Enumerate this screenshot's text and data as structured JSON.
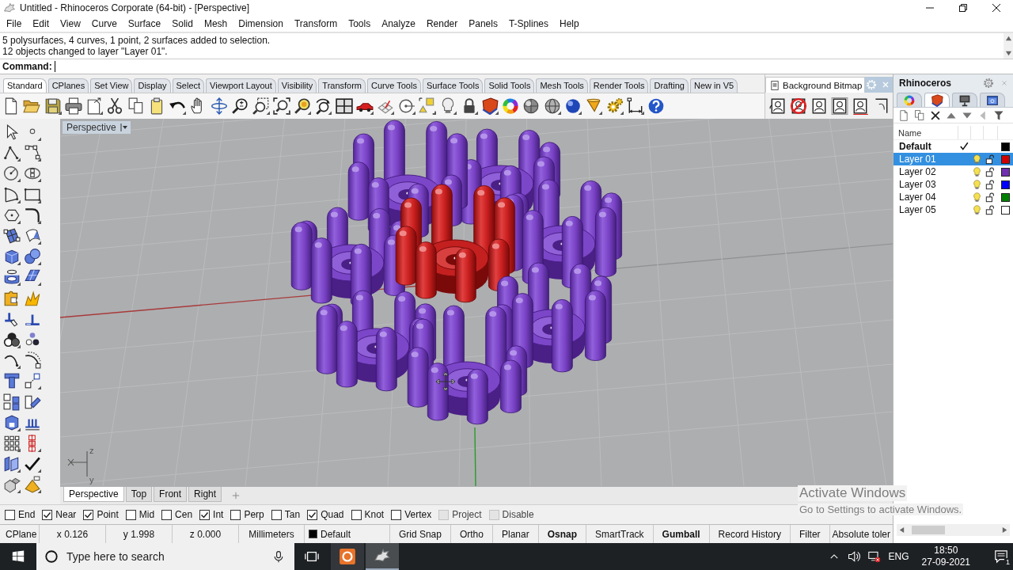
{
  "window": {
    "title": "Untitled - Rhinoceros Corporate (64-bit) - [Perspective]"
  },
  "menu": [
    "File",
    "Edit",
    "View",
    "Curve",
    "Surface",
    "Solid",
    "Mesh",
    "Dimension",
    "Transform",
    "Tools",
    "Analyze",
    "Render",
    "Panels",
    "T-Splines",
    "Help"
  ],
  "command_history": [
    "5 polysurfaces, 4 curves, 1 point, 2 surfaces added to selection.",
    "12 objects changed to layer \"Layer 01\"."
  ],
  "command": {
    "label": "Command:"
  },
  "toolbar_tabs": [
    {
      "label": "Standard",
      "selected": true
    },
    {
      "label": "CPlanes",
      "selected": false
    },
    {
      "label": "Set View",
      "selected": false
    },
    {
      "label": "Display",
      "selected": false
    },
    {
      "label": "Select",
      "selected": false
    },
    {
      "label": "Viewport Layout",
      "selected": false
    },
    {
      "label": "Visibility",
      "selected": false
    },
    {
      "label": "Transform",
      "selected": false
    },
    {
      "label": "Curve Tools",
      "selected": false
    },
    {
      "label": "Surface Tools",
      "selected": false
    },
    {
      "label": "Solid Tools",
      "selected": false
    },
    {
      "label": "Mesh Tools",
      "selected": false
    },
    {
      "label": "Render Tools",
      "selected": false
    },
    {
      "label": "Drafting",
      "selected": false
    },
    {
      "label": "New in V5",
      "selected": false
    }
  ],
  "bitmap_panel": {
    "title": "Background Bitmap"
  },
  "viewport": {
    "title": "Perspective",
    "axis_labels": [
      "z",
      "y"
    ]
  },
  "viewport_tabs": [
    {
      "label": "Perspective",
      "selected": true
    },
    {
      "label": "Top",
      "selected": false
    },
    {
      "label": "Front",
      "selected": false
    },
    {
      "label": "Right",
      "selected": false
    }
  ],
  "osnaps": [
    {
      "label": "End",
      "checked": false,
      "disabled": false
    },
    {
      "label": "Near",
      "checked": true,
      "disabled": false
    },
    {
      "label": "Point",
      "checked": true,
      "disabled": false
    },
    {
      "label": "Mid",
      "checked": false,
      "disabled": false
    },
    {
      "label": "Cen",
      "checked": false,
      "disabled": false
    },
    {
      "label": "Int",
      "checked": true,
      "disabled": false
    },
    {
      "label": "Perp",
      "checked": false,
      "disabled": false
    },
    {
      "label": "Tan",
      "checked": false,
      "disabled": false
    },
    {
      "label": "Quad",
      "checked": true,
      "disabled": false
    },
    {
      "label": "Knot",
      "checked": false,
      "disabled": false
    },
    {
      "label": "Vertex",
      "checked": false,
      "disabled": false
    },
    {
      "label": "Project",
      "checked": false,
      "disabled": true
    },
    {
      "label": "Disable",
      "checked": false,
      "disabled": true
    }
  ],
  "status_bar": {
    "cplane": "CPlane",
    "coordinates": [
      "x 0.126",
      "y 1.998",
      "z 0.000"
    ],
    "units": "Millimeters",
    "layer": {
      "name": "Default",
      "color": "#000000"
    },
    "toggles": [
      {
        "label": "Grid Snap",
        "on": false
      },
      {
        "label": "Ortho",
        "on": false
      },
      {
        "label": "Planar",
        "on": false
      },
      {
        "label": "Osnap",
        "on": true
      },
      {
        "label": "SmartTrack",
        "on": false
      },
      {
        "label": "Gumball",
        "on": true
      },
      {
        "label": "Record History",
        "on": false
      },
      {
        "label": "Filter",
        "on": false
      }
    ],
    "tolerance": "Absolute toler"
  },
  "layers_panel": {
    "title": "Rhinoceros",
    "tabs": [
      {
        "selected": false
      },
      {
        "selected": true
      },
      {
        "selected": false
      },
      {
        "selected": false
      }
    ],
    "column": "Name",
    "layers": [
      {
        "name": "Default",
        "current": true,
        "selected": false,
        "color": "#000000"
      },
      {
        "name": "Layer 01",
        "current": false,
        "selected": true,
        "visible": true,
        "locked": false,
        "color": "#d00000"
      },
      {
        "name": "Layer 02",
        "current": false,
        "selected": false,
        "visible": true,
        "locked": false,
        "color": "#7030b0"
      },
      {
        "name": "Layer 03",
        "current": false,
        "selected": false,
        "visible": true,
        "locked": false,
        "color": "#0000ff"
      },
      {
        "name": "Layer 04",
        "current": false,
        "selected": false,
        "visible": true,
        "locked": false,
        "color": "#008000"
      },
      {
        "name": "Layer 05",
        "current": false,
        "selected": false,
        "visible": true,
        "locked": false,
        "color": "#ffffff"
      }
    ]
  },
  "activation_notice": {
    "title": "Activate Windows",
    "message": "Go to Settings to activate Windows."
  },
  "taskbar": {
    "search": {
      "placeholder": "Type here to search"
    },
    "apps": [
      {
        "selected": false
      },
      {
        "selected": true
      }
    ],
    "language": "ENG",
    "time": "18:50",
    "date": "27-09-2021",
    "notification_count": "1"
  }
}
